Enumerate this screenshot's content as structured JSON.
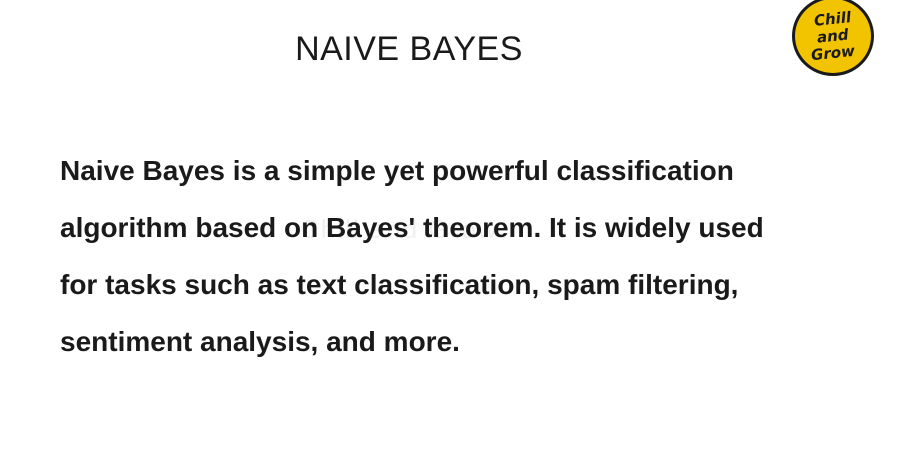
{
  "slide": {
    "title": "NAIVE BAYES",
    "body_lines": [
      "Naive Bayes is a simple yet powerful classification",
      "algorithm based on Bayes' theorem. It is widely used",
      "for tasks such as text classification, spam filtering,",
      "sentiment analysis, and more."
    ]
  },
  "logo": {
    "line1": "Chill",
    "line2": "and",
    "line3": "Grow",
    "color": "#f2c400"
  },
  "watermark": {
    "text": "Chill and Grow"
  }
}
